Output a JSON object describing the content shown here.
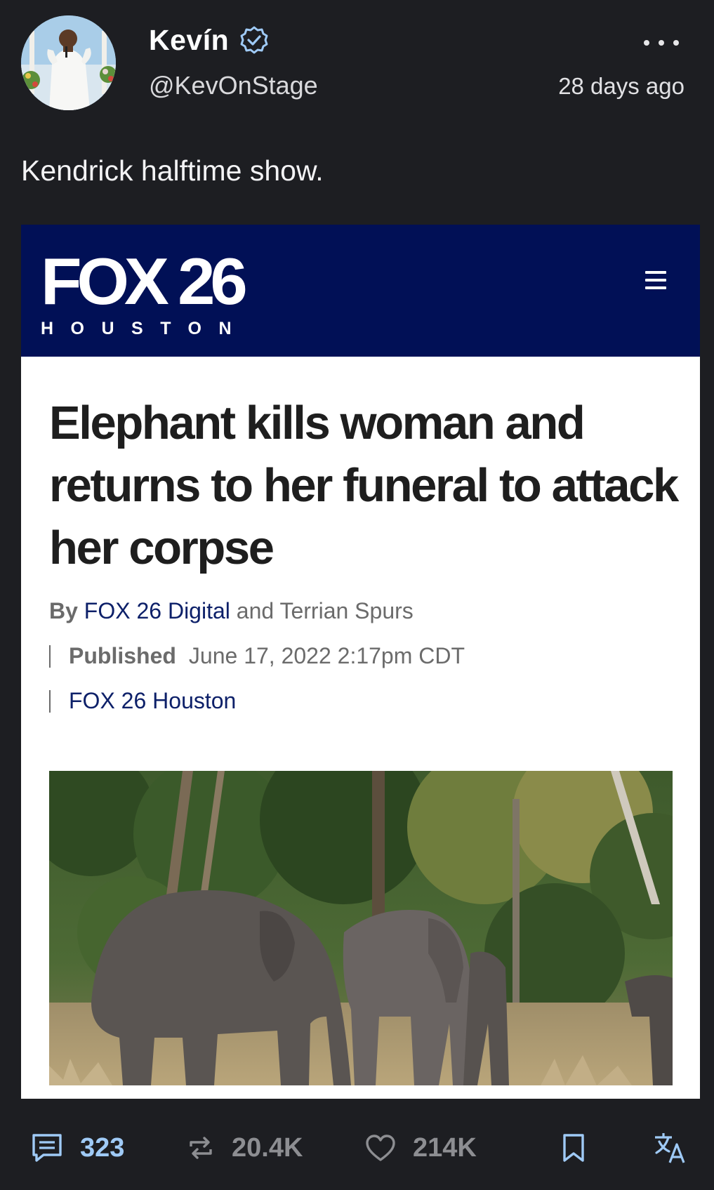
{
  "author": {
    "display_name": "Kevín",
    "handle": "@KevOnStage",
    "verified": true
  },
  "post": {
    "timestamp": "28 days ago",
    "text": "Kendrick halftime show."
  },
  "embedded_article": {
    "banner_color": "#011056",
    "logo_main": "FOX 26",
    "logo_sub": "HOUSTON",
    "headline": "Elephant kills woman and returns to her funeral to attack her corpse",
    "byline_by": "By",
    "byline_author_link": "FOX 26 Digital",
    "byline_rest": "and Terrian Spurs",
    "published_label": "Published",
    "published_date": "June 17, 2022 2:17pm CDT",
    "source_link": "FOX 26 Houston"
  },
  "actions": {
    "reply": {
      "icon": "reply-icon",
      "count": "323"
    },
    "repost": {
      "icon": "repost-icon",
      "count": "20.4K"
    },
    "like": {
      "icon": "heart-icon",
      "count": "214K"
    },
    "bookmark": {
      "icon": "bookmark-icon"
    },
    "translate": {
      "icon": "translate-icon"
    }
  },
  "colors": {
    "background": "#1d1e22",
    "accent": "#9fcaf6",
    "muted": "#8d8e92",
    "link": "#0d2069"
  }
}
